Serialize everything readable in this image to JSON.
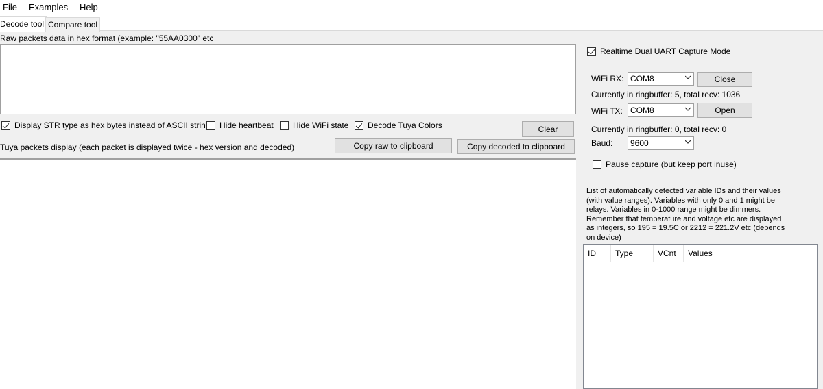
{
  "menu": {
    "items": [
      "File",
      "Examples",
      "Help"
    ]
  },
  "tabs": [
    "Decode tool",
    "Compare tool"
  ],
  "raw_input": {
    "label": "Raw packets data in hex format (example: \"55AA0300\" etc",
    "value": ""
  },
  "options": {
    "display_str_hex": {
      "label": "Display STR type as hex bytes instead of ASCII string",
      "checked": true
    },
    "hide_heartbeat": {
      "label": "Hide heartbeat",
      "checked": false
    },
    "hide_wifi_state": {
      "label": "Hide WiFi state",
      "checked": false
    },
    "decode_tuya_colors": {
      "label": "Decode Tuya Colors",
      "checked": true
    }
  },
  "buttons": {
    "clear": "Clear",
    "copy_raw": "Copy raw to clipboard",
    "copy_decoded": "Copy decoded to clipboard"
  },
  "packets_display": {
    "label": "Tuya packets display (each packet is displayed twice - hex version and decoded)"
  },
  "capture": {
    "realtime_mode": {
      "label": "Realtime Dual UART Capture Mode",
      "checked": true
    },
    "wifi_rx": {
      "label": "WiFi RX:",
      "port": "COM8",
      "button": "Close",
      "status": "Currently in ringbuffer: 5, total recv: 1036"
    },
    "wifi_tx": {
      "label": "WiFi TX:",
      "port": "COM8",
      "button": "Open",
      "status": "Currently in ringbuffer: 0, total recv: 0"
    },
    "baud": {
      "label": "Baud:",
      "value": "9600"
    },
    "pause": {
      "label": "Pause capture (but keep port inuse)",
      "checked": false
    }
  },
  "variables": {
    "description_lines": [
      "List of automatically detected variable IDs  and their values",
      "(with value ranges). Variables with only 0 and 1 might be",
      "relays. Variables in 0-1000 range might be dimmers.",
      "Remember that temperature and voltage etc are displayed",
      "as integers, so 195 = 19.5C or 2212 = 221.2V etc (depends",
      "on device)"
    ],
    "columns": [
      "ID",
      "Type",
      "VCnt",
      "Values"
    ],
    "rows": []
  }
}
